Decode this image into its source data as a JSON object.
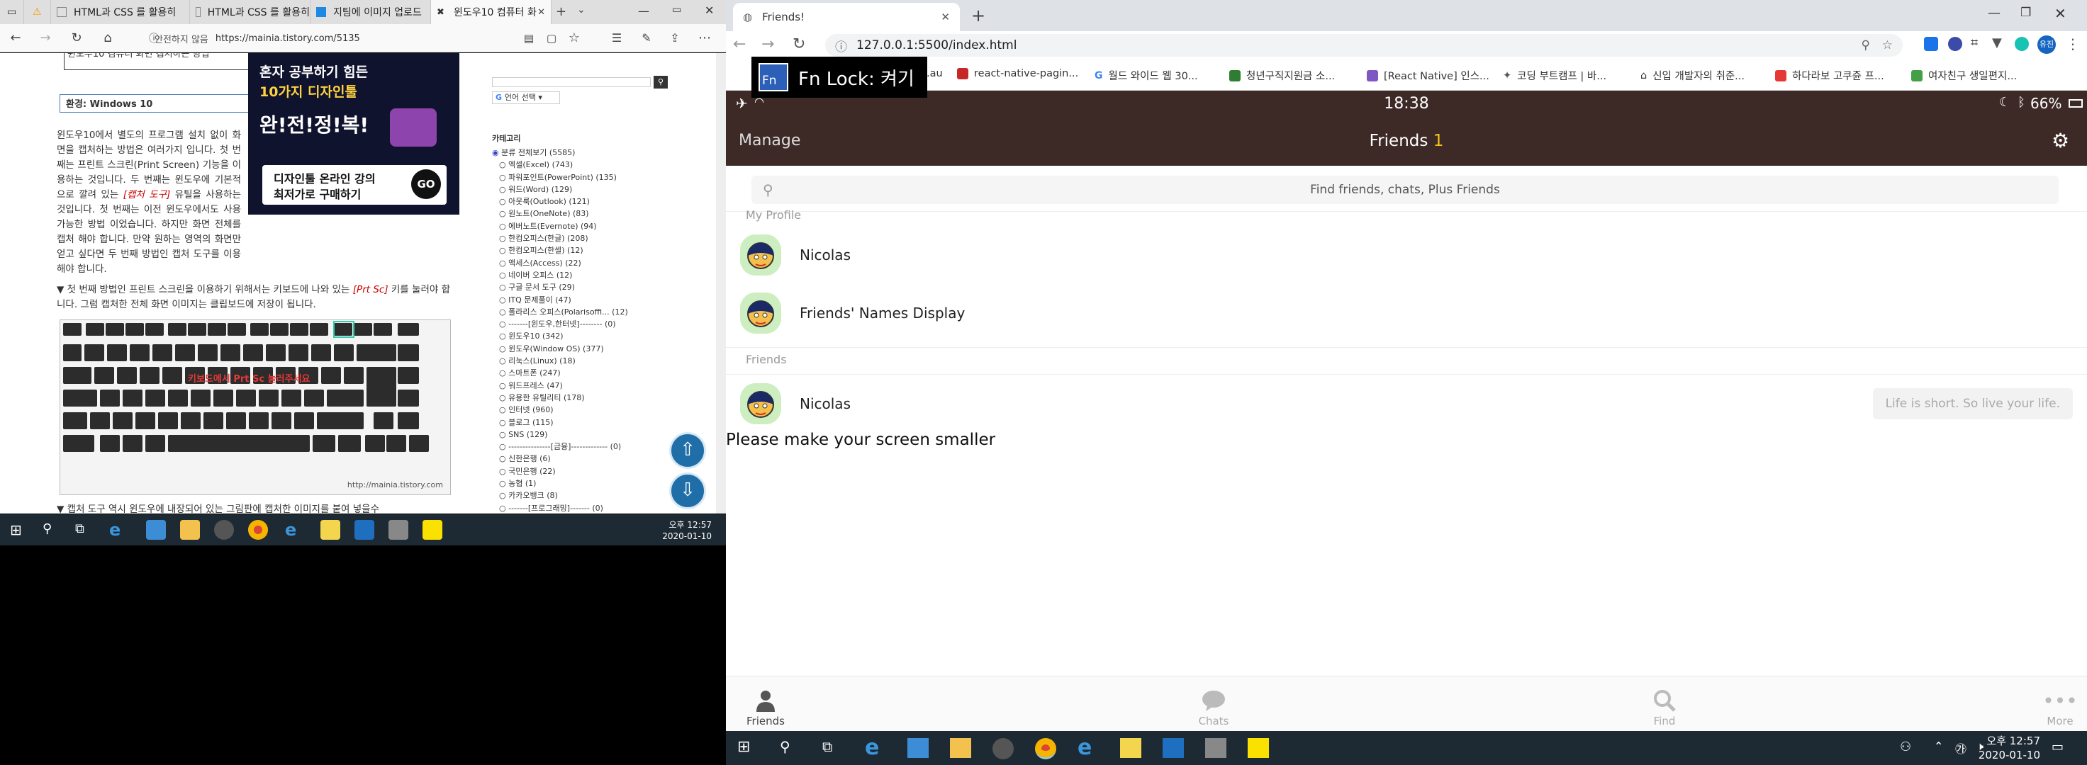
{
  "left": {
    "tabs": [
      {
        "label": "HTML과 CSS 를 활용히"
      },
      {
        "label": "HTML과 CSS 를 활용히"
      },
      {
        "label": "지팀에 이미지 업로드"
      },
      {
        "label": "윈도우10 컴퓨터 화"
      }
    ],
    "url_security": "안전하지 않음",
    "url": "https://mainia.tistory.com/5135",
    "article": {
      "heading_partial": "윈도우10 컴퓨터 화면 캡처하는 방법",
      "env_label": "환경: Windows 10",
      "para1": "윈도우10에서 별도의 프로그램 설치 없이 화면을 캡처하는 방법은 여러가지 입니다. 첫 번째는 프린트 스크린(Print Screen) 기능을 이용하는 것입니다. 두 번째는 윈도우에 기본적으로 깔려 있는",
      "para1_red": "[캡처 도구]",
      "para1_tail": "유틸을 사용하는 것입니다. 첫 번째는 이전 윈도우에서도 사용 가능한 방법 이었습니다. 하지만 화면 전체를 캡처 해야 합니다. 만약 원하는 영역의 화면만 얻고 싶다면 두 번째 방법인 캡처 도구를 이용해야 합니다.",
      "para2_a": "▼ 첫 번째 방법인 프린트 스크린을 이용하기 위해서는 키보드에 나와 있는",
      "para2_red": "[Prt Sc]",
      "para2_b": "키를 눌러야 합니다. 그럼 캡처한 전체 화면 이미지는 클립보드에 저장이 됩니다.",
      "kbd_caption": "http://mainia.tistory.com",
      "kbd_overlay": "키보드에서 Prt Sc 눌러주세요",
      "bottom_partial": "▼ 캡처 도구 역시 윈도우에 내장되어 있는 그림판에 캡처한 이미지를 붙여 넣을수"
    },
    "ad": {
      "line1": "혼자 공부하기 힘든",
      "line2": "10가지 디자인툴",
      "line3": "완!전!정!복!",
      "line4": "디자인툴 온라인 강의",
      "line5": "최저가로 구매하기",
      "go": "GO"
    },
    "sidebar": {
      "lang_select": "언어 선택",
      "category_title": "카테고리",
      "items": [
        "분류 전체보기 (5585)",
        "엑셀(Excel) (743)",
        "파워포인트(PowerPoint) (135)",
        "워드(Word) (129)",
        "아웃룩(Outlook) (121)",
        "원노트(OneNote) (83)",
        "에버노트(Evernote) (94)",
        "한컴오피스(한글) (208)",
        "한컴오피스(한셀) (12)",
        "액세스(Access) (22)",
        "네이버 오피스 (12)",
        "구글 문서 도구 (29)",
        "ITQ 문제풀이 (47)",
        "폴라리스 오피스(Polarisoffi... (12)",
        "-------[윈도우,한터넷]-------- (0)",
        "윈도우10 (342)",
        "윈도우(Window OS) (377)",
        "리눅스(Linux) (18)",
        "스마트폰 (247)",
        "워드프레스 (47)",
        "유용한 유틸리티 (178)",
        "인터넷 (960)",
        "블로그 (115)",
        "SNS (129)",
        "---------------[금융]------------- (0)",
        "신한은행 (6)",
        "국민은행 (22)",
        "농협 (1)",
        "카카오뱅크 (8)",
        "-------[프로그래밍]------- (0)"
      ]
    },
    "taskbar_clock": {
      "time": "오후 12:57",
      "date": "2020-01-10"
    }
  },
  "right": {
    "tab_title": "Friends!",
    "url": "127.0.0.1:5500/index.html",
    "fn_lock": "Fn  Lock: 켜기",
    "fn_icon": "Fn",
    "bookmarks": [
      {
        "label": "om.au",
        "color": "#4a90d9"
      },
      {
        "label": "react-native-pagin...",
        "color": "#c62828"
      },
      {
        "label": "월드 와이드 웹 30...",
        "color": "#4285f4"
      },
      {
        "label": "청년구직지원금 소...",
        "color": "#2e7d32"
      },
      {
        "label": "[React Native] 인스...",
        "color": "#7e57c2"
      },
      {
        "label": "코딩 부트캠프 | 바...",
        "color": "#555555"
      },
      {
        "label": "신입 개발자의 취준...",
        "color": "#333333"
      },
      {
        "label": "하다라보 고쿠쥰 프...",
        "color": "#e53935"
      },
      {
        "label": "여자친구 생일편지...",
        "color": "#43a047"
      }
    ],
    "app": {
      "status_time": "18:38",
      "battery": "66%",
      "manage": "Manage",
      "title": "Friends",
      "count": "1",
      "search_placeholder": "Find friends, chats, Plus Friends",
      "my_profile_label": "My Profile",
      "friends_label": "Friends",
      "my_profile": [
        {
          "name": "Nicolas"
        },
        {
          "name": "Friends' Names Display"
        }
      ],
      "friends": [
        {
          "name": "Nicolas",
          "status": "Life is short. So live your life."
        }
      ],
      "notice": "Please make your screen smaller",
      "tabs": [
        {
          "label": "Friends",
          "icon": "person-icon"
        },
        {
          "label": "Chats",
          "icon": "chat-icon"
        },
        {
          "label": "Find",
          "icon": "search-icon"
        },
        {
          "label": "More",
          "icon": "more-icon"
        }
      ]
    },
    "taskbar_clock": {
      "time": "오후 12:57",
      "date": "2020-01-10"
    }
  },
  "colors": {
    "app_header": "#3d2a27",
    "accent_count": "#f5c518",
    "taskbar": "#1e2a33"
  }
}
